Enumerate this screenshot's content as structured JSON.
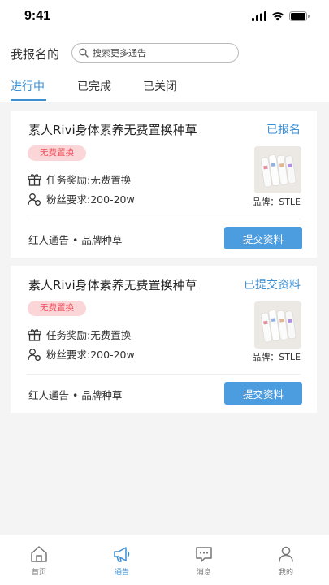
{
  "status_bar": {
    "time": "9:41"
  },
  "header": {
    "title": "我报名的",
    "search": {
      "placeholder": "搜索更多通告",
      "value": ""
    },
    "tabs": [
      {
        "label": "进行中",
        "active": true
      },
      {
        "label": "已完成",
        "active": false
      },
      {
        "label": "已关闭",
        "active": false
      }
    ]
  },
  "cards": [
    {
      "title": "素人Rivi身体素养无费置换种草",
      "status": "已报名",
      "tag": "无费置换",
      "reward": "任务奖励:无费置换",
      "fans": "粉丝要求:200-20w",
      "brand": "品牌：STLE",
      "tags": "红人通告 • 品牌种草",
      "button": "提交资料"
    },
    {
      "title": "素人Rivi身体素养无费置换种草",
      "status": "已提交资料",
      "tag": "无费置换",
      "reward": "任务奖励:无费置换",
      "fans": "粉丝要求:200-20w",
      "brand": "品牌：STLE",
      "tags": "红人通告 • 品牌种草",
      "button": "提交资料"
    }
  ],
  "bottom_nav": [
    {
      "label": "首页",
      "icon": "home-icon",
      "active": false
    },
    {
      "label": "通告",
      "icon": "megaphone-icon",
      "active": true
    },
    {
      "label": "消息",
      "icon": "message-icon",
      "active": false
    },
    {
      "label": "我的",
      "icon": "user-icon",
      "active": false
    }
  ],
  "colors": {
    "accent": "#3d8fd3",
    "button": "#4c9ce0",
    "tag_bg": "#fbd6d8",
    "tag_text": "#f04f5c"
  }
}
